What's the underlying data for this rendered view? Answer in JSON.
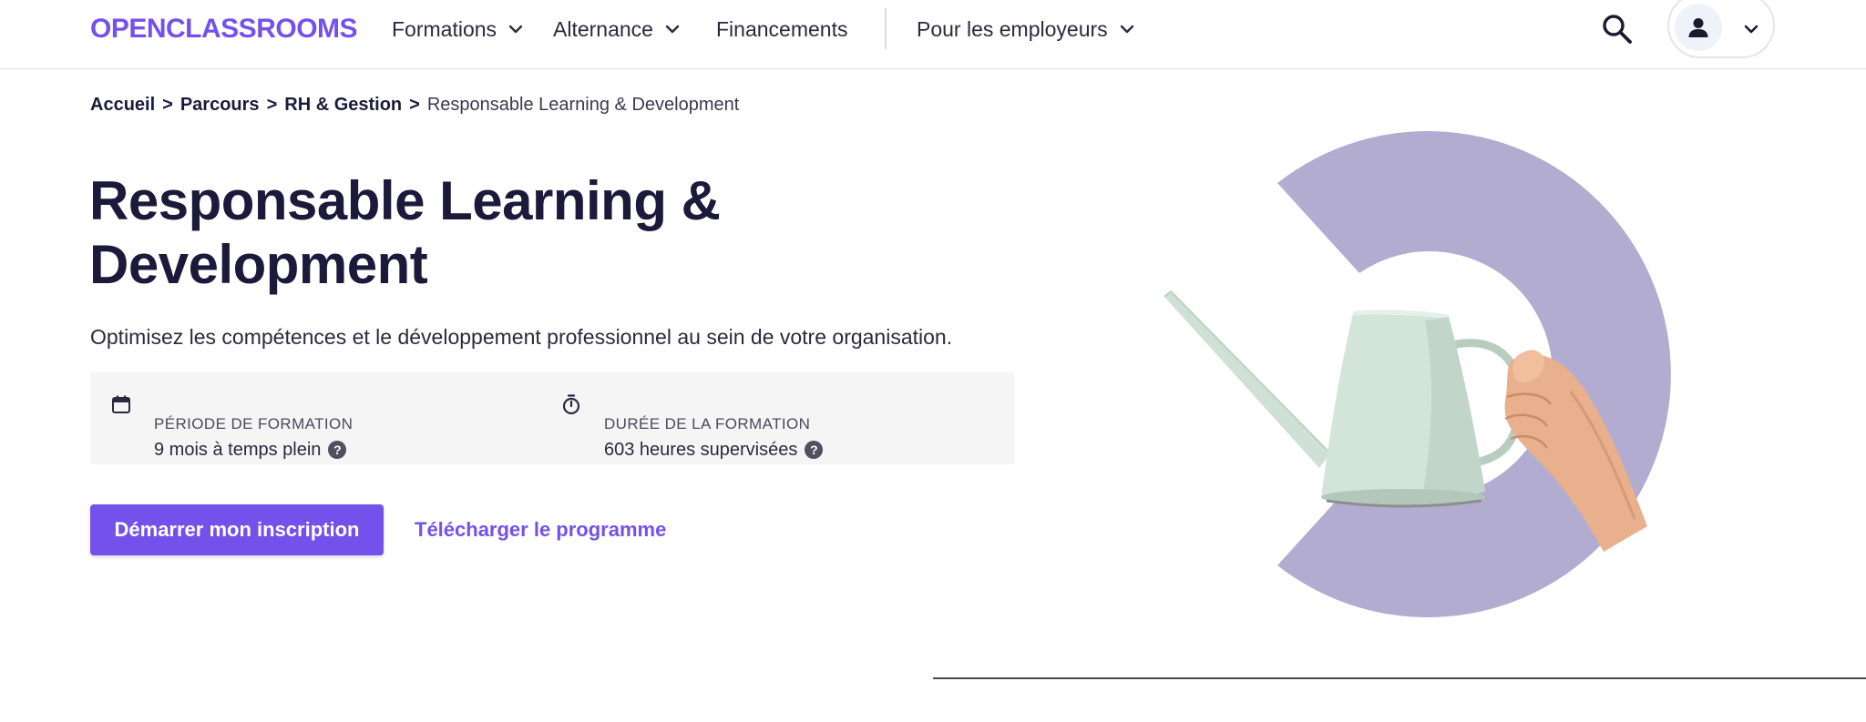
{
  "header": {
    "logo_text": "OPENCLASSROOMS",
    "nav": [
      {
        "label": "Formations",
        "has_dropdown": true
      },
      {
        "label": "Alternance",
        "has_dropdown": true
      },
      {
        "label": "Financements",
        "has_dropdown": false
      },
      {
        "label": "Pour les employeurs",
        "has_dropdown": true
      }
    ],
    "icons": {
      "search": "search-icon",
      "account": "user-icon",
      "account_menu": "chevron-down-icon"
    }
  },
  "breadcrumb": {
    "items": [
      {
        "label": "Accueil",
        "sep": ">"
      },
      {
        "label": "Parcours",
        "sep": ">"
      },
      {
        "label": "RH & Gestion",
        "sep": ">"
      }
    ],
    "current": "Responsable Learning & Development"
  },
  "hero": {
    "title_line1": "Responsable Learning &",
    "title_line2": "Development",
    "subtitle": "Optimisez les compétences et le développement professionnel au sein de votre organisation.",
    "info": {
      "period_label": "PÉRIODE DE FORMATION",
      "period_value": "9 mois à temps plein",
      "duration_label": "DURÉE DE LA FORMATION",
      "duration_value": "603 heures supervisées",
      "help_glyph": "?"
    },
    "cta_primary": "Démarrer mon inscription",
    "cta_secondary": "Télécharger le programme"
  },
  "colors": {
    "brand": "#7451eb",
    "illustration_ring": "#b2acd0",
    "watering_can": "#cfe1d6",
    "title": "#1c1a3a",
    "info_bg": "#f5f5f6"
  }
}
